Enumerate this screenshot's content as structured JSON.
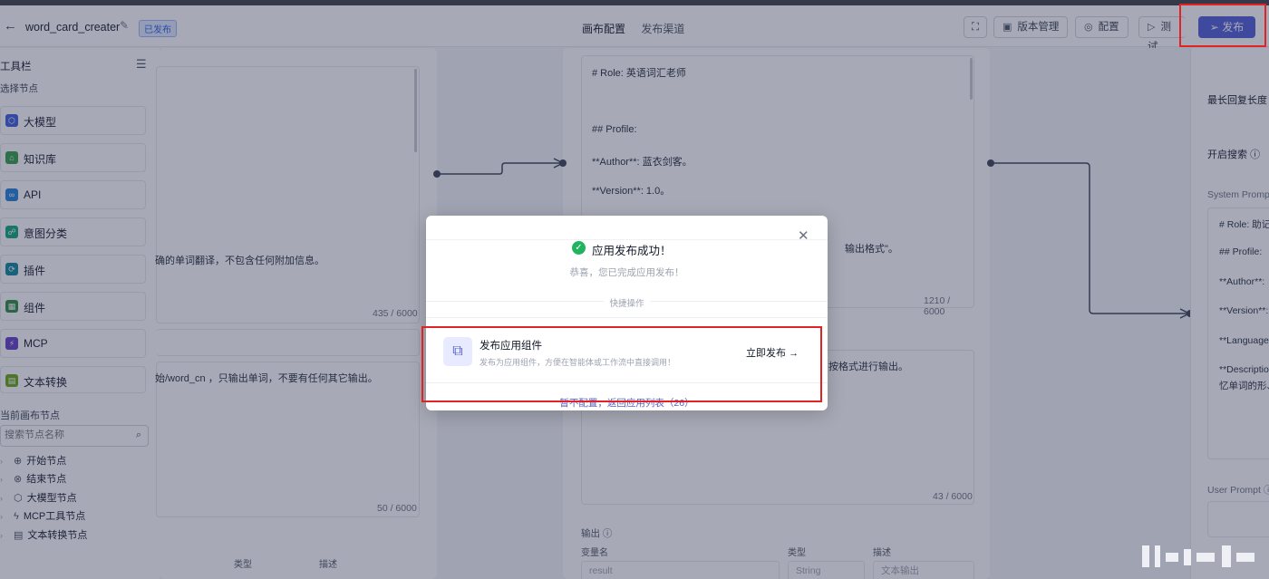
{
  "header": {
    "back_icon": "back-arrow-icon",
    "app_name": "word_card_creater",
    "status_badge": "已发布",
    "tab_canvas": "画布配置",
    "tab_channel": "发布渠道",
    "version_btn": "版本管理",
    "config_btn": "配置",
    "test_btn": "测试",
    "publish_btn": "发布"
  },
  "sidebar": {
    "title": "工具栏",
    "select_nodes": "选择节点",
    "nodes": [
      {
        "label": "大模型",
        "icon": "model-icon",
        "color": "#3b5bdb"
      },
      {
        "label": "知识库",
        "icon": "knowledge-icon",
        "color": "#2f9e44"
      },
      {
        "label": "API",
        "icon": "api-icon",
        "color": "#1c7ed6"
      },
      {
        "label": "意图分类",
        "icon": "intent-icon",
        "color": "#0ca678"
      },
      {
        "label": "插件",
        "icon": "plugin-icon",
        "color": "#0c8599"
      },
      {
        "label": "组件",
        "icon": "component-icon",
        "color": "#2b8a3e"
      },
      {
        "label": "MCP",
        "icon": "mcp-icon",
        "color": "#5f3dc4"
      },
      {
        "label": "文本转换",
        "icon": "text-convert-icon",
        "color": "#66a80f"
      }
    ],
    "canvas_nodes_title": "当前画布节点",
    "search_placeholder": "搜索节点名称",
    "tree": [
      {
        "label": "开始节点",
        "icon": "start-icon"
      },
      {
        "label": "结束节点",
        "icon": "end-icon"
      },
      {
        "label": "大模型节点",
        "icon": "model-node-icon"
      },
      {
        "label": "MCP工具节点",
        "icon": "mcp-tool-icon"
      },
      {
        "label": "文本转换节点",
        "icon": "text-node-icon"
      }
    ]
  },
  "canvas": {
    "left_card": {
      "text1": "确的单词翻译，不包含任何附加信息。",
      "counter1": "435 / 6000",
      "text2": "始/word_cn ，只输出单词，不要有任何其它输出。",
      "counter2": "50 / 6000",
      "col_type": "类型",
      "col_desc": "描述"
    },
    "mid_card": {
      "lines": [
        "# Role: 英语词汇老师",
        "## Profile:",
        "**Author**: 蓝衣剑客。",
        "**Version**: 1.0。",
        "输出格式\"。"
      ],
      "counter1": "1210 / 6000",
      "text2": "按格式进行输出。",
      "counter2": "43 / 6000",
      "output_label": "输出",
      "col_var": "变量名",
      "col_type": "类型",
      "col_desc": "描述",
      "var_value": "result",
      "type_value": "String",
      "desc_value": "文本输出"
    },
    "right_panel": {
      "max_reply": "最长回复长度",
      "web_search": "开启搜索",
      "system_prompt": "System Prompt",
      "lines": [
        "# Role: 助记",
        "## Profile:",
        "**Author**: ",
        "**Version**:",
        "**Language**",
        "**Description",
        "忆单词的形、"
      ],
      "user_prompt": "User Prompt"
    }
  },
  "modal": {
    "close_icon": "close-icon",
    "success_title": "应用发布成功！",
    "success_sub": "恭喜，您已完成应用发布！",
    "divider": "快捷操作",
    "action_title": "发布应用组件",
    "action_desc": "发布为应用组件，方便在智能体或工作流中直接调用！",
    "action_link": "立即发布",
    "back_link": "暂不配置，返回应用列表（26）"
  }
}
